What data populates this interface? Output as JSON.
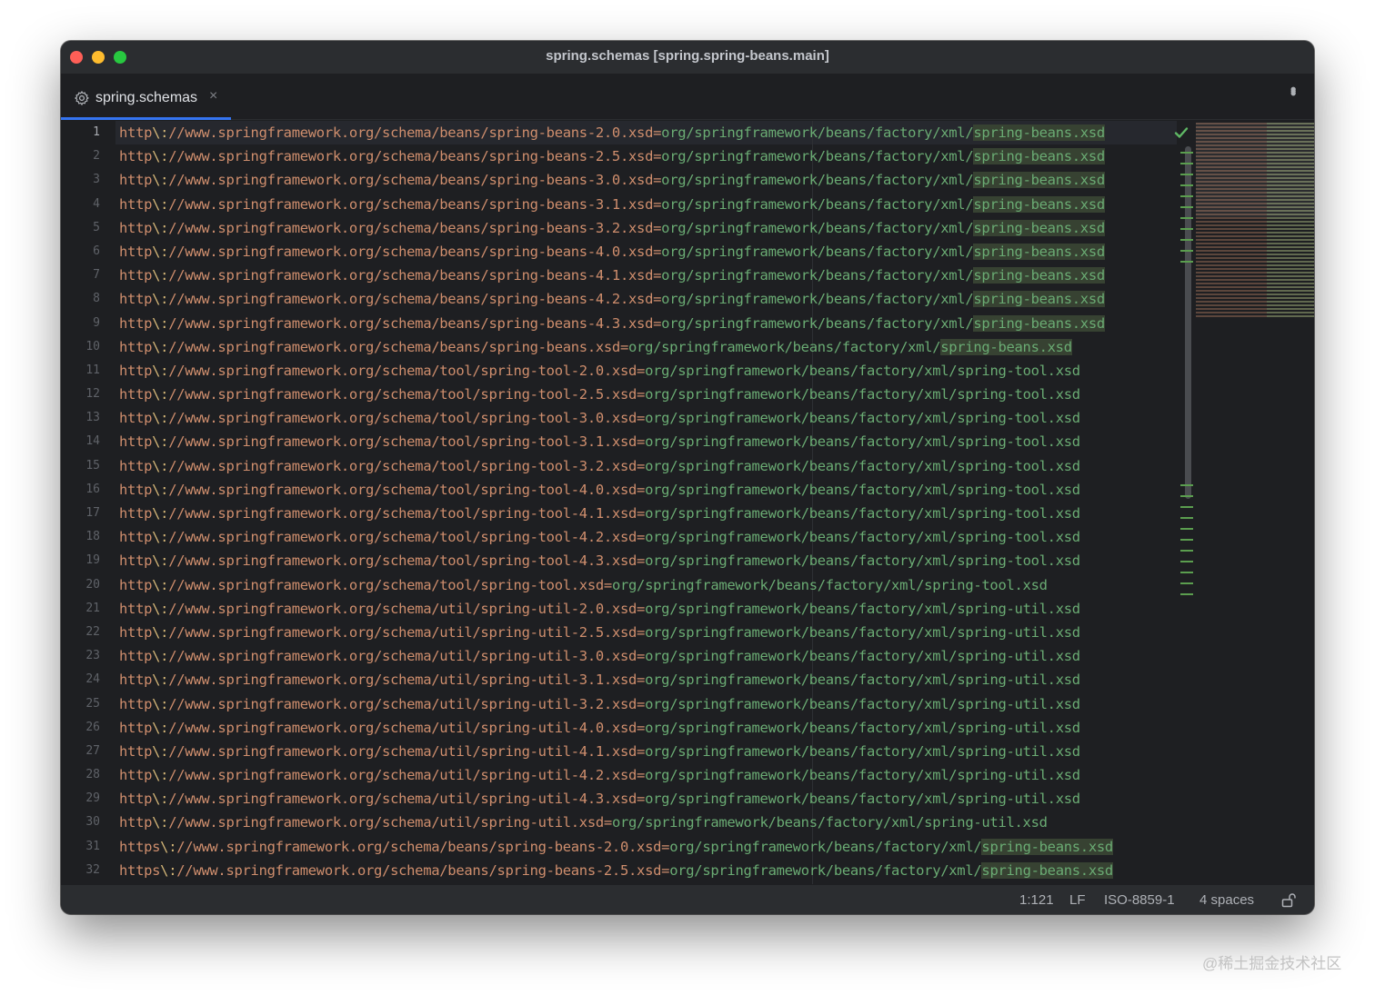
{
  "window": {
    "title": "spring.schemas [spring.spring-beans.main]"
  },
  "tab": {
    "label": "spring.schemas",
    "icon": "gear-icon",
    "close": "×"
  },
  "editor": {
    "lines": [
      {
        "n": "1",
        "key": "http",
        "esc": "\\:",
        "url": "//www.springframework.org/schema/beans/spring-beans-2.0.xsd",
        "eq": "=",
        "path": "org/springframework/beans/factory/xml/",
        "file": "spring-beans.xsd",
        "hl": true
      },
      {
        "n": "2",
        "key": "http",
        "esc": "\\:",
        "url": "//www.springframework.org/schema/beans/spring-beans-2.5.xsd",
        "eq": "=",
        "path": "org/springframework/beans/factory/xml/",
        "file": "spring-beans.xsd",
        "hl": true
      },
      {
        "n": "3",
        "key": "http",
        "esc": "\\:",
        "url": "//www.springframework.org/schema/beans/spring-beans-3.0.xsd",
        "eq": "=",
        "path": "org/springframework/beans/factory/xml/",
        "file": "spring-beans.xsd",
        "hl": true
      },
      {
        "n": "4",
        "key": "http",
        "esc": "\\:",
        "url": "//www.springframework.org/schema/beans/spring-beans-3.1.xsd",
        "eq": "=",
        "path": "org/springframework/beans/factory/xml/",
        "file": "spring-beans.xsd",
        "hl": true
      },
      {
        "n": "5",
        "key": "http",
        "esc": "\\:",
        "url": "//www.springframework.org/schema/beans/spring-beans-3.2.xsd",
        "eq": "=",
        "path": "org/springframework/beans/factory/xml/",
        "file": "spring-beans.xsd",
        "hl": true
      },
      {
        "n": "6",
        "key": "http",
        "esc": "\\:",
        "url": "//www.springframework.org/schema/beans/spring-beans-4.0.xsd",
        "eq": "=",
        "path": "org/springframework/beans/factory/xml/",
        "file": "spring-beans.xsd",
        "hl": true
      },
      {
        "n": "7",
        "key": "http",
        "esc": "\\:",
        "url": "//www.springframework.org/schema/beans/spring-beans-4.1.xsd",
        "eq": "=",
        "path": "org/springframework/beans/factory/xml/",
        "file": "spring-beans.xsd",
        "hl": true
      },
      {
        "n": "8",
        "key": "http",
        "esc": "\\:",
        "url": "//www.springframework.org/schema/beans/spring-beans-4.2.xsd",
        "eq": "=",
        "path": "org/springframework/beans/factory/xml/",
        "file": "spring-beans.xsd",
        "hl": true
      },
      {
        "n": "9",
        "key": "http",
        "esc": "\\:",
        "url": "//www.springframework.org/schema/beans/spring-beans-4.3.xsd",
        "eq": "=",
        "path": "org/springframework/beans/factory/xml/",
        "file": "spring-beans.xsd",
        "hl": true
      },
      {
        "n": "10",
        "key": "http",
        "esc": "\\:",
        "url": "//www.springframework.org/schema/beans/spring-beans.xsd",
        "eq": "=",
        "path": "org/springframework/beans/factory/xml/",
        "file": "spring-beans.xsd",
        "hl": true
      },
      {
        "n": "11",
        "key": "http",
        "esc": "\\:",
        "url": "//www.springframework.org/schema/tool/spring-tool-2.0.xsd",
        "eq": "=",
        "path": "org/springframework/beans/factory/xml/",
        "file": "spring-tool.xsd",
        "hl": false
      },
      {
        "n": "12",
        "key": "http",
        "esc": "\\:",
        "url": "//www.springframework.org/schema/tool/spring-tool-2.5.xsd",
        "eq": "=",
        "path": "org/springframework/beans/factory/xml/",
        "file": "spring-tool.xsd",
        "hl": false
      },
      {
        "n": "13",
        "key": "http",
        "esc": "\\:",
        "url": "//www.springframework.org/schema/tool/spring-tool-3.0.xsd",
        "eq": "=",
        "path": "org/springframework/beans/factory/xml/",
        "file": "spring-tool.xsd",
        "hl": false
      },
      {
        "n": "14",
        "key": "http",
        "esc": "\\:",
        "url": "//www.springframework.org/schema/tool/spring-tool-3.1.xsd",
        "eq": "=",
        "path": "org/springframework/beans/factory/xml/",
        "file": "spring-tool.xsd",
        "hl": false
      },
      {
        "n": "15",
        "key": "http",
        "esc": "\\:",
        "url": "//www.springframework.org/schema/tool/spring-tool-3.2.xsd",
        "eq": "=",
        "path": "org/springframework/beans/factory/xml/",
        "file": "spring-tool.xsd",
        "hl": false
      },
      {
        "n": "16",
        "key": "http",
        "esc": "\\:",
        "url": "//www.springframework.org/schema/tool/spring-tool-4.0.xsd",
        "eq": "=",
        "path": "org/springframework/beans/factory/xml/",
        "file": "spring-tool.xsd",
        "hl": false
      },
      {
        "n": "17",
        "key": "http",
        "esc": "\\:",
        "url": "//www.springframework.org/schema/tool/spring-tool-4.1.xsd",
        "eq": "=",
        "path": "org/springframework/beans/factory/xml/",
        "file": "spring-tool.xsd",
        "hl": false
      },
      {
        "n": "18",
        "key": "http",
        "esc": "\\:",
        "url": "//www.springframework.org/schema/tool/spring-tool-4.2.xsd",
        "eq": "=",
        "path": "org/springframework/beans/factory/xml/",
        "file": "spring-tool.xsd",
        "hl": false
      },
      {
        "n": "19",
        "key": "http",
        "esc": "\\:",
        "url": "//www.springframework.org/schema/tool/spring-tool-4.3.xsd",
        "eq": "=",
        "path": "org/springframework/beans/factory/xml/",
        "file": "spring-tool.xsd",
        "hl": false
      },
      {
        "n": "20",
        "key": "http",
        "esc": "\\:",
        "url": "//www.springframework.org/schema/tool/spring-tool.xsd",
        "eq": "=",
        "path": "org/springframework/beans/factory/xml/",
        "file": "spring-tool.xsd",
        "hl": false
      },
      {
        "n": "21",
        "key": "http",
        "esc": "\\:",
        "url": "//www.springframework.org/schema/util/spring-util-2.0.xsd",
        "eq": "=",
        "path": "org/springframework/beans/factory/xml/",
        "file": "spring-util.xsd",
        "hl": false
      },
      {
        "n": "22",
        "key": "http",
        "esc": "\\:",
        "url": "//www.springframework.org/schema/util/spring-util-2.5.xsd",
        "eq": "=",
        "path": "org/springframework/beans/factory/xml/",
        "file": "spring-util.xsd",
        "hl": false
      },
      {
        "n": "23",
        "key": "http",
        "esc": "\\:",
        "url": "//www.springframework.org/schema/util/spring-util-3.0.xsd",
        "eq": "=",
        "path": "org/springframework/beans/factory/xml/",
        "file": "spring-util.xsd",
        "hl": false
      },
      {
        "n": "24",
        "key": "http",
        "esc": "\\:",
        "url": "//www.springframework.org/schema/util/spring-util-3.1.xsd",
        "eq": "=",
        "path": "org/springframework/beans/factory/xml/",
        "file": "spring-util.xsd",
        "hl": false
      },
      {
        "n": "25",
        "key": "http",
        "esc": "\\:",
        "url": "//www.springframework.org/schema/util/spring-util-3.2.xsd",
        "eq": "=",
        "path": "org/springframework/beans/factory/xml/",
        "file": "spring-util.xsd",
        "hl": false
      },
      {
        "n": "26",
        "key": "http",
        "esc": "\\:",
        "url": "//www.springframework.org/schema/util/spring-util-4.0.xsd",
        "eq": "=",
        "path": "org/springframework/beans/factory/xml/",
        "file": "spring-util.xsd",
        "hl": false
      },
      {
        "n": "27",
        "key": "http",
        "esc": "\\:",
        "url": "//www.springframework.org/schema/util/spring-util-4.1.xsd",
        "eq": "=",
        "path": "org/springframework/beans/factory/xml/",
        "file": "spring-util.xsd",
        "hl": false
      },
      {
        "n": "28",
        "key": "http",
        "esc": "\\:",
        "url": "//www.springframework.org/schema/util/spring-util-4.2.xsd",
        "eq": "=",
        "path": "org/springframework/beans/factory/xml/",
        "file": "spring-util.xsd",
        "hl": false
      },
      {
        "n": "29",
        "key": "http",
        "esc": "\\:",
        "url": "//www.springframework.org/schema/util/spring-util-4.3.xsd",
        "eq": "=",
        "path": "org/springframework/beans/factory/xml/",
        "file": "spring-util.xsd",
        "hl": false
      },
      {
        "n": "30",
        "key": "http",
        "esc": "\\:",
        "url": "//www.springframework.org/schema/util/spring-util.xsd",
        "eq": "=",
        "path": "org/springframework/beans/factory/xml/",
        "file": "spring-util.xsd",
        "hl": false
      },
      {
        "n": "31",
        "key": "https",
        "esc": "\\:",
        "url": "//www.springframework.org/schema/beans/spring-beans-2.0.xsd",
        "eq": "=",
        "path": "org/springframework/beans/factory/xml/",
        "file": "spring-beans.xsd",
        "hl": true
      },
      {
        "n": "32",
        "key": "https",
        "esc": "\\:",
        "url": "//www.springframework.org/schema/beans/spring-beans-2.5.xsd",
        "eq": "=",
        "path": "org/springframework/beans/factory/xml/",
        "file": "spring-beans.xsd",
        "hl": true
      }
    ]
  },
  "inspection": {
    "icon": "check-icon"
  },
  "statusbar": {
    "position": "1:121",
    "line_separator": "LF",
    "encoding": "ISO-8859-1",
    "indent": "4 spaces",
    "lock_icon": "unlock-icon"
  },
  "watermark": "@稀土掘金技术社区",
  "colors": {
    "key": "#cf8e6d",
    "escape": "#d5b778",
    "value": "#6aab73",
    "highlight_bg": "#374232",
    "tab_underline": "#3574f0"
  }
}
